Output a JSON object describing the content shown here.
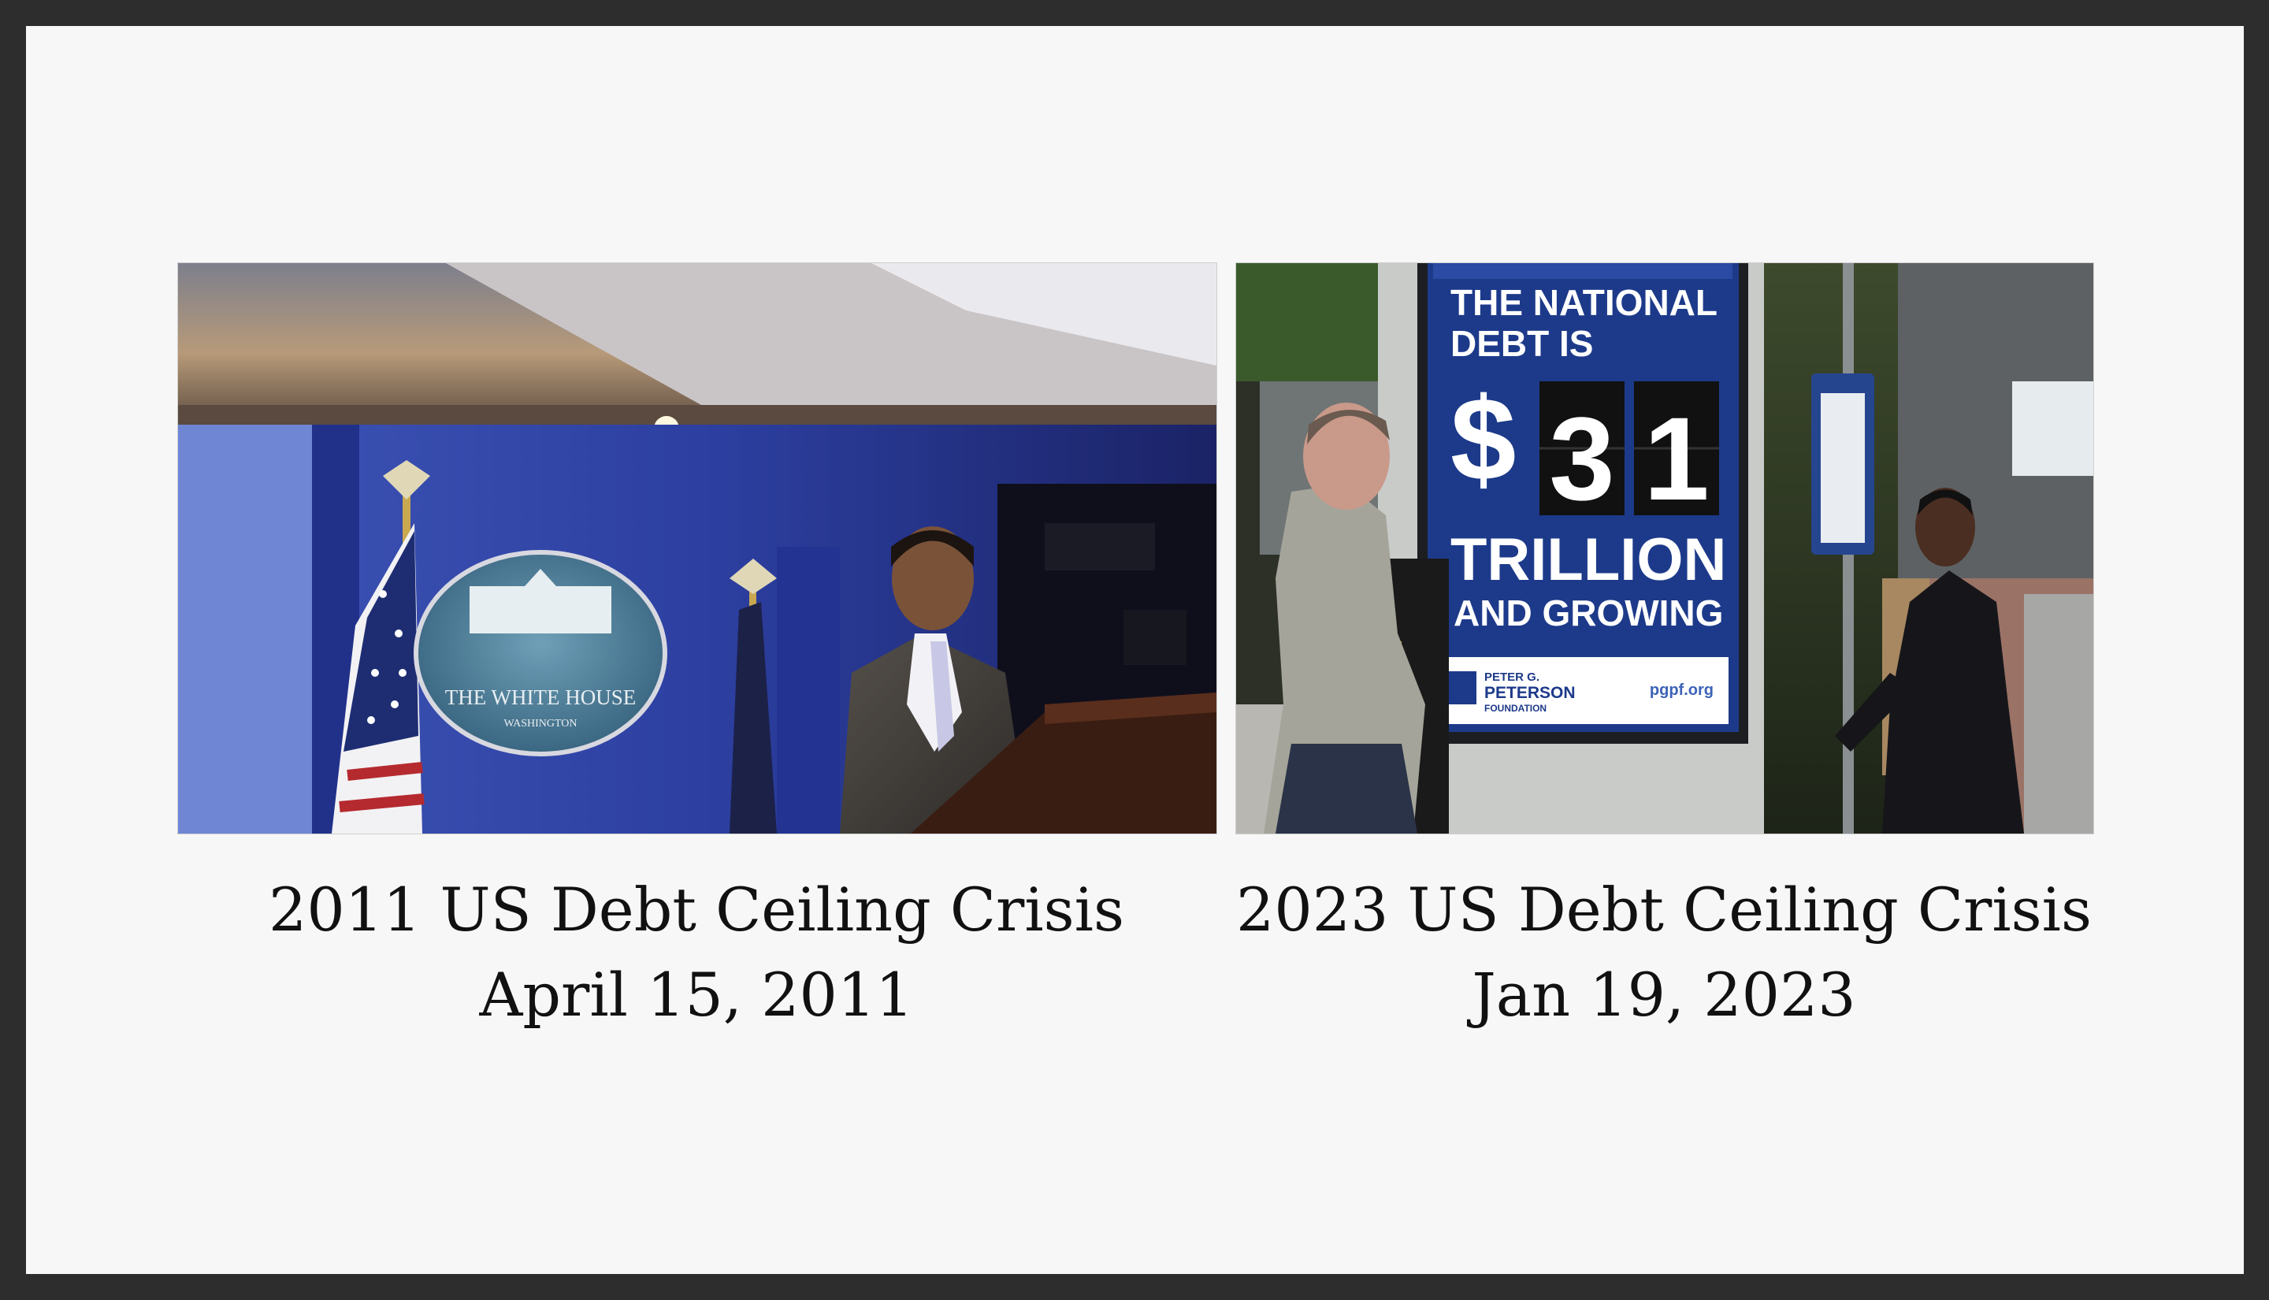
{
  "left_panel": {
    "photo_seal_line1": "THE WHITE HOUSE",
    "photo_seal_line2": "WASHINGTON",
    "title": "2011 US Debt Ceiling Crisis",
    "date": "April 15, 2011"
  },
  "right_panel": {
    "poster": {
      "line1": "THE NATIONAL",
      "line2": "DEBT IS",
      "dollar": "$",
      "digit1": "3",
      "digit2": "1",
      "line3": "TRILLION",
      "line4": "AND GROWING",
      "foundation_line1": "PETER G.",
      "foundation_line2": "PETERSON",
      "foundation_line3": "FOUNDATION",
      "url": "pgpf.org"
    },
    "title": "2023 US Debt Ceiling Crisis",
    "date": "Jan 19, 2023"
  },
  "colors": {
    "frame": "#2d2d2d",
    "slide": "#f7f7f7",
    "poster_blue": "#1d3a8a",
    "briefing_blue": "#2a3f9e"
  }
}
